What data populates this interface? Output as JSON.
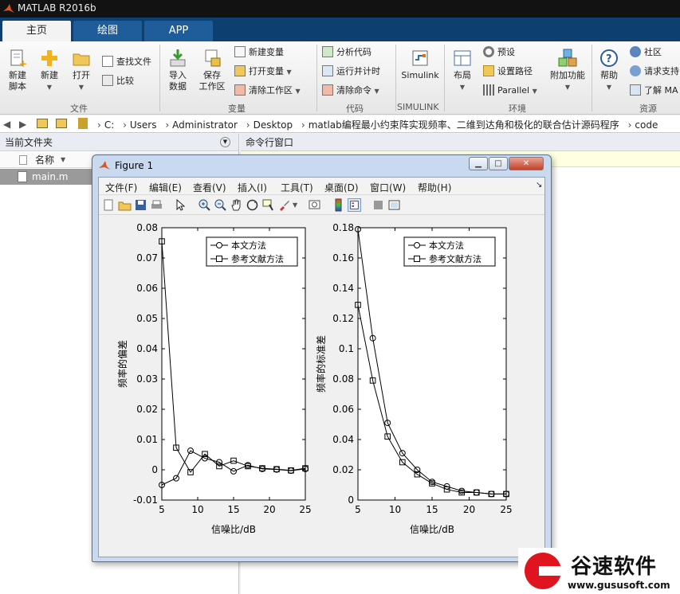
{
  "app": {
    "title": "MATLAB R2016b"
  },
  "tabs": [
    {
      "label": "主页"
    },
    {
      "label": "绘图"
    },
    {
      "label": "APP"
    }
  ],
  "ribbon": {
    "file": {
      "new_script": "新建\n脚本",
      "new": "新建",
      "open": "打开",
      "find_files": "查找文件",
      "compare": "比较",
      "label": "文件"
    },
    "variable": {
      "import": "导入\n数据",
      "save_ws": "保存\n工作区",
      "new_var": "新建变量",
      "open_var": "打开变量",
      "clear_ws": "清除工作区",
      "label": "变量"
    },
    "code": {
      "analyze": "分析代码",
      "run_time": "运行并计时",
      "clear_cmd": "清除命令",
      "label": "代码"
    },
    "simulink": {
      "button": "Simulink",
      "label": "SIMULINK"
    },
    "environment": {
      "layout": "布局",
      "prefs": "预设",
      "set_path": "设置路径",
      "parallel": "Parallel",
      "addons": "附加功能",
      "label": "环境"
    },
    "resources": {
      "help": "帮助",
      "community": "社区",
      "request_support": "请求支持",
      "learn": "了解 MA",
      "label": "资源"
    }
  },
  "path": [
    "C:",
    "Users",
    "Administrator",
    "Desktop",
    "matlab编程最小约束阵实现频率、二维到达角和极化的联合估计源码程序",
    "code"
  ],
  "current_folder": {
    "title": "当前文件夹",
    "col_name": "名称",
    "files": [
      "main.m"
    ]
  },
  "command_window": {
    "title": "命令行窗口"
  },
  "figure": {
    "title": "Figure 1",
    "menu": [
      "文件(F)",
      "编辑(E)",
      "查看(V)",
      "插入(I)",
      "工具(T)",
      "桌面(D)",
      "窗口(W)",
      "帮助(H)"
    ]
  },
  "chart_data": [
    {
      "type": "line",
      "xlabel": "信噪比/dB",
      "ylabel": "频率的偏差",
      "xlim": [
        5,
        25
      ],
      "ylim": [
        -0.01,
        0.08
      ],
      "xticks": [
        5,
        10,
        15,
        20,
        25
      ],
      "yticks": [
        -0.01,
        0,
        0.01,
        0.02,
        0.03,
        0.04,
        0.05,
        0.06,
        0.07,
        0.08
      ],
      "ytick_labels": [
        "-0.01",
        "0",
        "0.01",
        "0.02",
        "0.03",
        "0.04",
        "0.05",
        "0.06",
        "0.07",
        "0.08"
      ],
      "legend_position": "top-right",
      "x": [
        5,
        7,
        9,
        11,
        13,
        15,
        17,
        19,
        21,
        23,
        25
      ],
      "series": [
        {
          "name": "本文方法",
          "marker": "circle",
          "values": [
            -0.005,
            -0.0028,
            0.0063,
            0.0038,
            0.0025,
            -0.0005,
            0.0015,
            0.0003,
            0.0001,
            -0.0003,
            0.0003
          ]
        },
        {
          "name": "参考文献方法",
          "marker": "square",
          "values": [
            0.0755,
            0.0073,
            -0.0008,
            0.0052,
            0.0012,
            0.003,
            0.0012,
            0.0005,
            0.0002,
            -0.0002,
            0.0005
          ]
        }
      ]
    },
    {
      "type": "line",
      "xlabel": "信噪比/dB",
      "ylabel": "频率的标准差",
      "xlim": [
        5,
        25
      ],
      "ylim": [
        0,
        0.18
      ],
      "xticks": [
        5,
        10,
        15,
        20,
        25
      ],
      "yticks": [
        0,
        0.02,
        0.04,
        0.06,
        0.08,
        0.1,
        0.12,
        0.14,
        0.16,
        0.18
      ],
      "ytick_labels": [
        "0",
        "0.02",
        "0.04",
        "0.06",
        "0.08",
        "0.1",
        "0.12",
        "0.14",
        "0.16",
        "0.18"
      ],
      "legend_position": "top-right",
      "x": [
        5,
        7,
        9,
        11,
        13,
        15,
        17,
        19,
        21,
        23,
        25
      ],
      "series": [
        {
          "name": "本文方法",
          "marker": "circle",
          "values": [
            0.179,
            0.107,
            0.051,
            0.031,
            0.02,
            0.012,
            0.009,
            0.006,
            0.005,
            0.004,
            0.004
          ]
        },
        {
          "name": "参考文献方法",
          "marker": "square",
          "values": [
            0.129,
            0.079,
            0.042,
            0.025,
            0.017,
            0.011,
            0.007,
            0.005,
            0.005,
            0.004,
            0.004
          ]
        }
      ]
    }
  ],
  "watermark": {
    "text": "谷速软件",
    "url": "www.gususoft.com"
  },
  "colors": {
    "title_bar": "#121212",
    "tab_bar": "#0e3f71",
    "ribbon": "#f0f0f0",
    "selected_row": "#9a9a9a",
    "watermark_red": "#e0141e"
  }
}
